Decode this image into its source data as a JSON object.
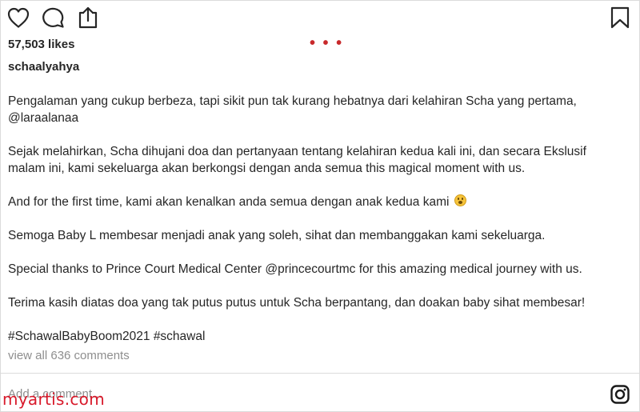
{
  "post": {
    "likes": "57,503 likes",
    "more_dots": "• • •",
    "username": "schaalyahya",
    "caption": {
      "p1_line1": "Pengalaman yang cukup berbeza, tapi sikit pun tak kurang hebatnya dari kelahiran Scha yang pertama,",
      "p1_line2": "@laraalanaa",
      "p2_line1": "Sejak melahirkan, Scha dihujani doa dan pertanyaan tentang kelahiran kedua kali ini, dan secara Ekslusif",
      "p2_line2": "malam ini, kami sekeluarga akan berkongsi dengan anda semua this magical moment with us.",
      "p3": "And for the first time, kami akan kenalkan anda semua dengan anak kedua kami",
      "p4": "Semoga Baby L membesar menjadi anak yang soleh, sihat dan membanggakan kami sekeluarga.",
      "p5": "Special thanks to Prince Court Medical Center @princecourtmc for this amazing medical journey with us.",
      "p6": "Terima kasih diatas doa yang tak putus putus untuk Scha berpantang, dan doakan baby sihat membesar!",
      "hashtags": "#SchawalBabyBoom2021 #schawal"
    },
    "view_comments": "view all 636 comments",
    "comment_placeholder": "Add a comment..."
  },
  "icons": {
    "like": "heart-icon",
    "comment": "speech-bubble-icon",
    "share": "share-icon",
    "save": "bookmark-icon",
    "emoji": "astonished-face-emoji",
    "brand": "instagram-logo-icon"
  },
  "watermark": "myartis.com",
  "colors": {
    "text": "#262626",
    "muted": "#8e8e8e",
    "divider": "#dbdbdb",
    "watermark": "#d8192a"
  }
}
